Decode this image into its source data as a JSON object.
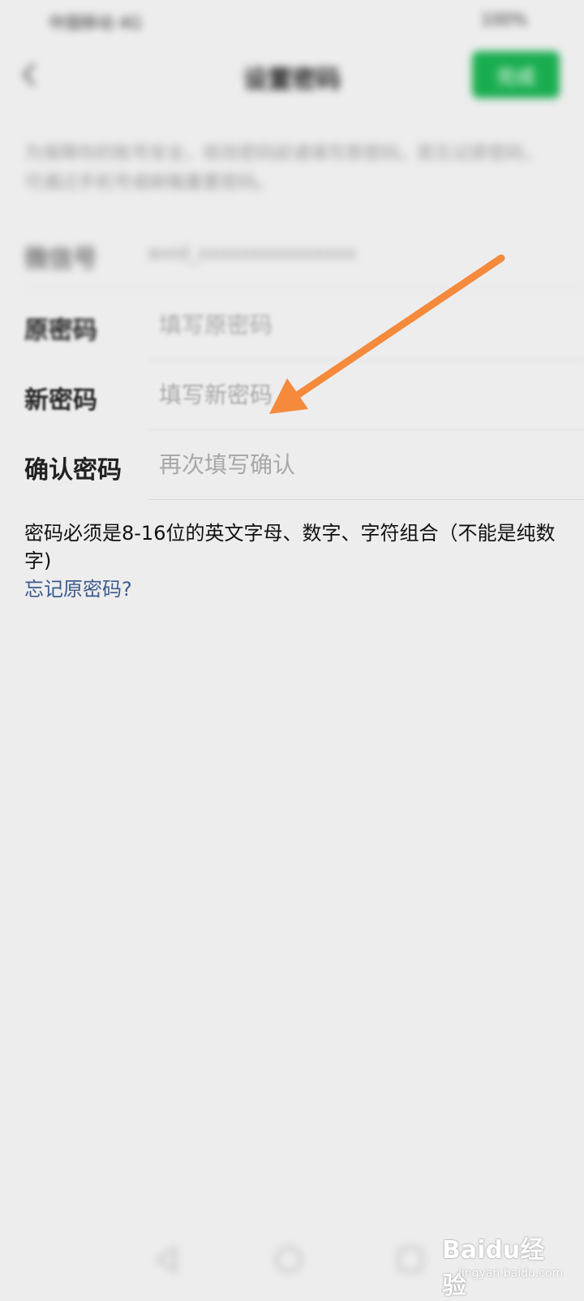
{
  "status_bar": {
    "left": "中国移动 4G",
    "right": "100%"
  },
  "header": {
    "title": "设置密码",
    "done_label": "完成"
  },
  "description": "为保障你的账号安全，修改密码前请填写原密码。若忘记原密码，可通过手机号或邮箱重置密码。",
  "fields": {
    "account": {
      "label": "微信号",
      "value": "wxid_xxxxxxxxxxxxxxx"
    },
    "old_password": {
      "label": "原密码",
      "placeholder": "填写原密码"
    },
    "new_password": {
      "label": "新密码",
      "placeholder": "填写新密码"
    },
    "confirm_password": {
      "label": "确认密码",
      "placeholder": "再次填写确认"
    }
  },
  "hint": "密码必须是8-16位的英文字母、数字、字符组合（不能是纯数字)",
  "forgot_link": "忘记原密码?",
  "watermark": {
    "text": "Baidu经验",
    "sub": "jingyan.baidu.com"
  },
  "colors": {
    "accent": "#1aad50",
    "link": "#3d5b8f",
    "arrow": "#f58a3c",
    "background": "#ededed"
  }
}
